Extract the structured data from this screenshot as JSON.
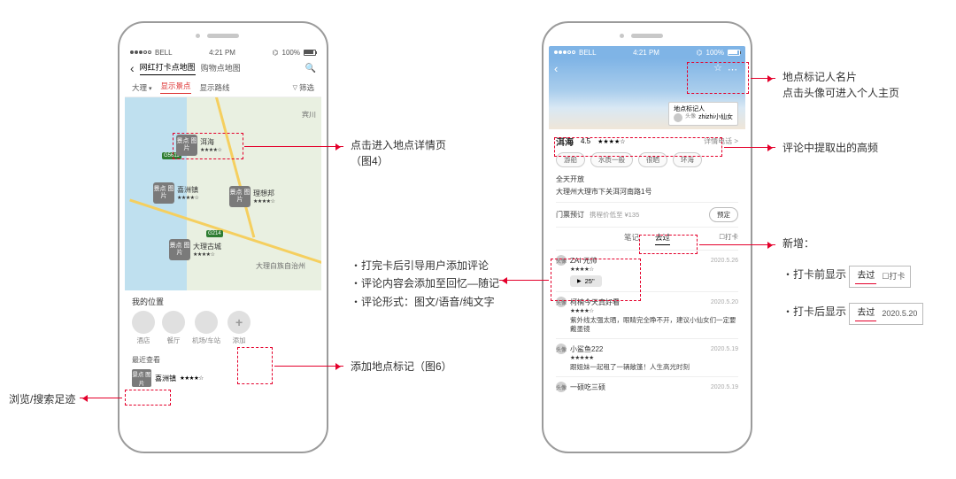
{
  "status": {
    "carrier": "BELL",
    "time": "4:21 PM",
    "battery": "100%"
  },
  "phone1": {
    "tabs": {
      "t1": "网红打卡点地图",
      "t2": "购物点地图"
    },
    "filters": {
      "city": "大理",
      "f1": "显示景点",
      "f2": "显示路线",
      "f3": "筛选"
    },
    "map": {
      "hw": {
        "a": "G5611",
        "b": "G214"
      },
      "cities": {
        "a": "宾川",
        "b": "大理白族自治州"
      },
      "pins": {
        "thumb": "景点\n图片",
        "p1": "洱海",
        "p2": "喜洲镇",
        "p3": "理想邦",
        "p4": "大理古城"
      }
    },
    "panel": {
      "title": "我的位置",
      "cats": {
        "c1": "酒店",
        "c2": "餐厅",
        "c3": "机场/车站",
        "c4": "添加"
      },
      "recent": {
        "label": "最近查看",
        "item": "喜洲镇",
        "thumb": "景点\n图片"
      }
    }
  },
  "phone2": {
    "marker_card": {
      "title": "地点标记人",
      "avatar_label": "头像",
      "name": "zhizhi小仙女"
    },
    "place": {
      "name": "洱海",
      "rating": "4.5",
      "detail_link": "详情电话 >"
    },
    "chips": {
      "c1": "游船",
      "c2": "水质一般",
      "c3": "很晒",
      "c4": "环海"
    },
    "open": "全天开放",
    "addr": "大理州大理市下关洱河南路1号",
    "ticket": {
      "label": "门票预订",
      "sub": "携程价低至  ¥135",
      "btn": "预定"
    },
    "tabs2": {
      "t1": "笔记",
      "t2": "去过",
      "daka": "打卡"
    },
    "reviews": {
      "av_label": "头像",
      "r1": {
        "name": "ZAI 元帅",
        "date": "2020.5.26",
        "voice": "25\""
      },
      "r2": {
        "name": "柯楠今天真好看",
        "date": "2020.5.20",
        "text": "紫外线太强太晒，眼睛完全睁不开，建议小仙女们一定要戴墨镜"
      },
      "r3": {
        "name": "小鲨鱼222",
        "date": "2020.5.19",
        "text": "跟姐妹一起租了一辆敞篷！人生高光时刻"
      },
      "r4": {
        "name": "一硕吃三硕",
        "date": "2020.5.19"
      }
    }
  },
  "ann": {
    "left": "浏览/搜索足迹",
    "a1": "点击进入地点详情页\n（图4）",
    "a2": "・打完卡后引导用户添加评论\n・评论内容会添加至回忆—随记\n・评论形式：图文/语音/纯文字",
    "a3": "添加地点标记（图6）",
    "r1": "地点标记人名片\n点击头像可进入个人主页",
    "r2": "评论中提取出的高频",
    "r3": "新增：",
    "r3a": "・打卡前显示",
    "r3b": "・打卡后显示",
    "mini": {
      "qg": "去过",
      "daka": "打卡",
      "date": "2020.5.20"
    }
  }
}
